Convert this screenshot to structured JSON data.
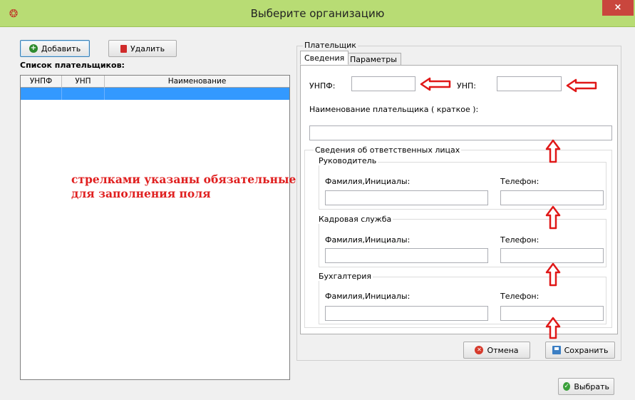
{
  "window": {
    "title": "Выберите организацию",
    "close_glyph": "×",
    "app_icon": "app-logo-icon"
  },
  "toolbar": {
    "add_label": "Добавить",
    "delete_label": "Удалить"
  },
  "payers_list": {
    "label": "Список плательщиков:",
    "columns": [
      "УНПФ",
      "УНП",
      "Наименование"
    ],
    "rows": [
      {
        "unpf": "",
        "unp": "",
        "name": ""
      }
    ]
  },
  "annotation": {
    "line1": "стрелками указаны обязательные",
    "line2": "для заполнения поля"
  },
  "payer": {
    "group_label": "Плательщик",
    "tabs": [
      "Сведения",
      "Параметры"
    ],
    "active_tab": 0,
    "unpf_label": "УНПФ:",
    "unpf_value": "",
    "unp_label": "УНП:",
    "unp_value": "",
    "short_name_label": "Наименование плательщика ( краткое ):",
    "short_name_value": "",
    "responsible": {
      "label": "Сведения об ответственных лицах",
      "sections": [
        {
          "title": "Руководитель",
          "name_label": "Фамилия,Инициалы:",
          "name_value": "",
          "phone_label": "Телефон:",
          "phone_value": ""
        },
        {
          "title": "Кадровая служба",
          "name_label": "Фамилия,Инициалы:",
          "name_value": "",
          "phone_label": "Телефон:",
          "phone_value": ""
        },
        {
          "title": "Бухгалтерия",
          "name_label": "Фамилия,Инициалы:",
          "name_value": "",
          "phone_label": "Телефон:",
          "phone_value": ""
        }
      ]
    }
  },
  "actions": {
    "cancel_label": "Отмена",
    "save_label": "Сохранить",
    "select_label": "Выбрать"
  },
  "colors": {
    "titlebar": "#b8dc74",
    "close": "#c9463d",
    "selection": "#3399ff",
    "annotation": "#e02020"
  }
}
